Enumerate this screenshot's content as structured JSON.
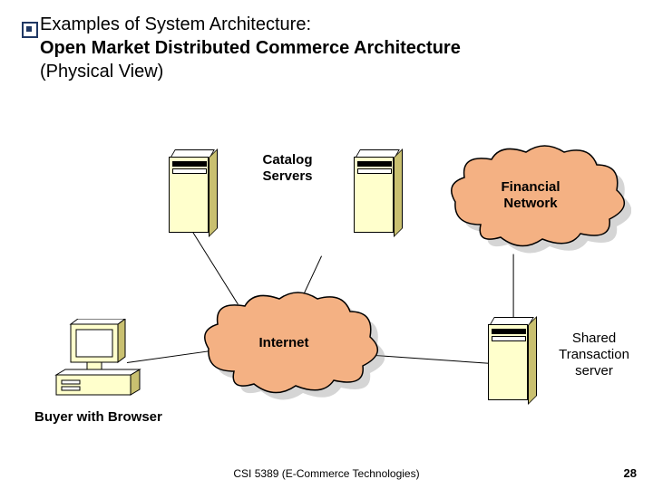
{
  "title": {
    "line1": "Examples of System Architecture:",
    "line2": "Open Market Distributed Commerce Architecture",
    "line3": "(Physical View)"
  },
  "labels": {
    "catalog_servers": "Catalog\nServers",
    "financial_network": "Financial\nNetwork",
    "internet": "Internet",
    "shared_transaction_server": "Shared\nTransaction\nserver",
    "buyer_with_browser": "Buyer with Browser"
  },
  "footer": "CSI 5389 (E-Commerce Technologies)",
  "page": "28",
  "cloud_fill": "#F4B183",
  "cloud_stroke": "#000000",
  "server_fill": "#FFFFCC"
}
